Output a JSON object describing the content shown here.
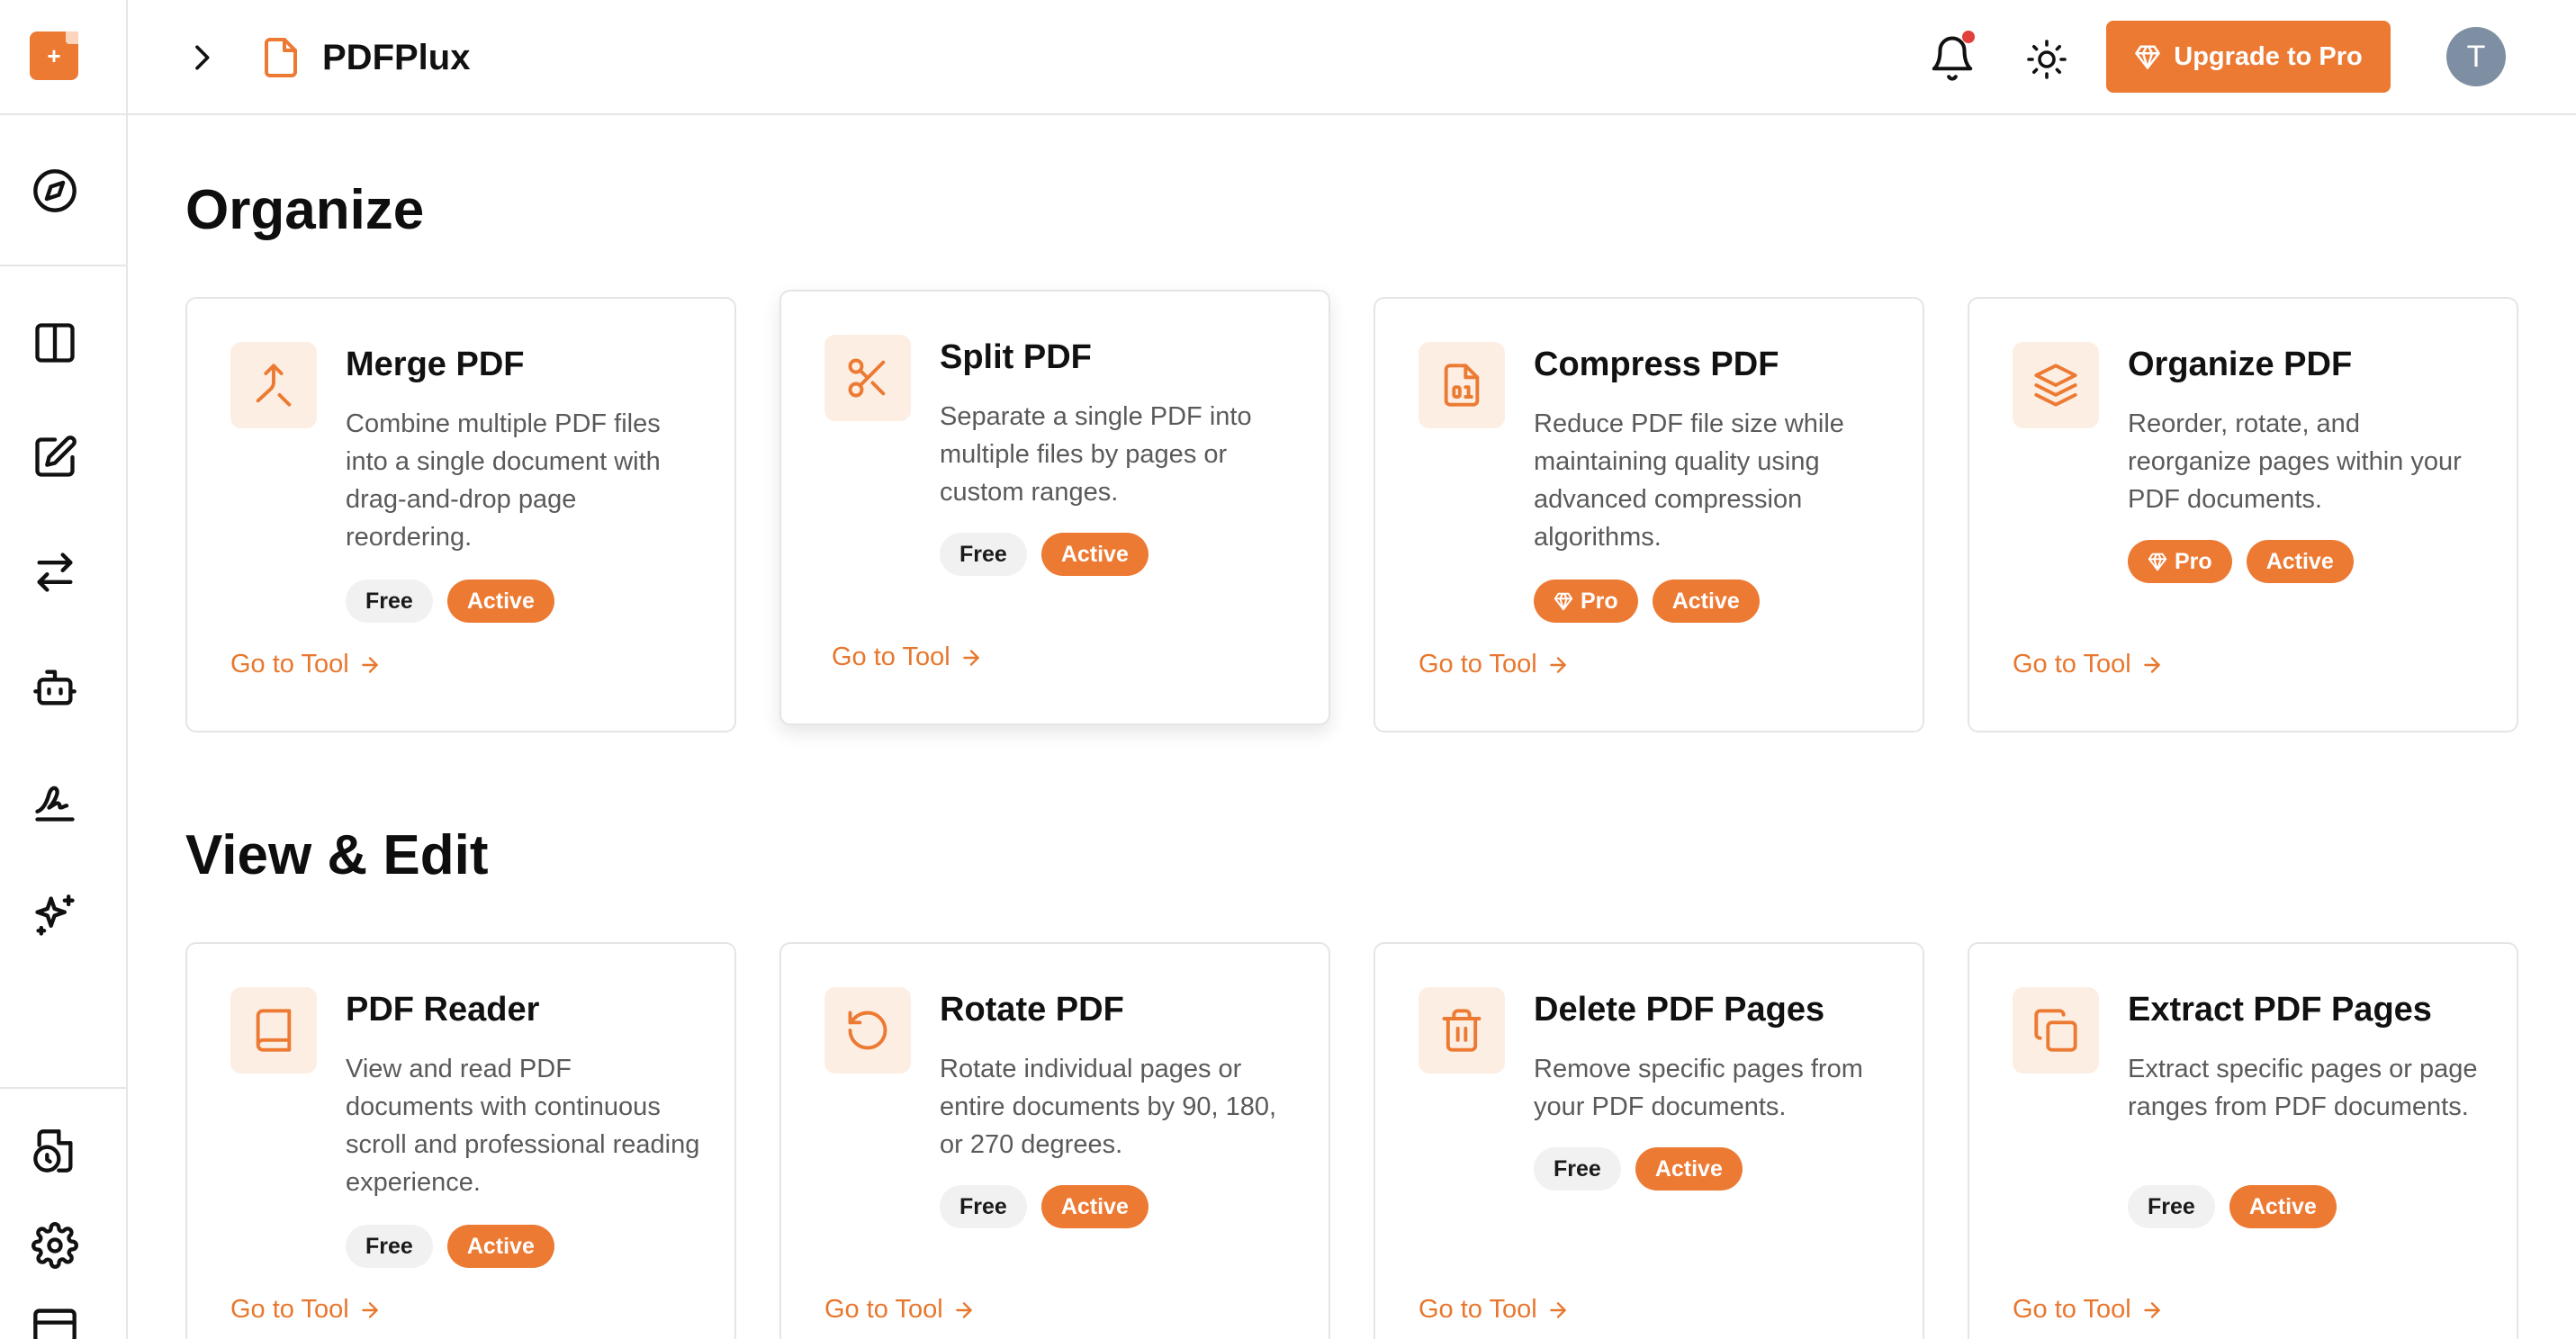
{
  "app": {
    "title": "PDFPlux",
    "logo_glyph": "+"
  },
  "header": {
    "upgrade_label": "Upgrade to Pro",
    "avatar_initial": "T",
    "notification_dot_color": "#e0413b"
  },
  "colors": {
    "accent": "#ec7a33",
    "accent_soft": "#fdeee3"
  },
  "sidebar": {
    "items": [
      {
        "icon": "compass-icon"
      },
      {
        "icon": "columns-icon"
      },
      {
        "icon": "edit-icon"
      },
      {
        "icon": "convert-arrows-icon"
      },
      {
        "icon": "bot-icon"
      },
      {
        "icon": "signature-icon"
      },
      {
        "icon": "sparkles-icon"
      },
      {
        "icon": "file-history-icon"
      },
      {
        "icon": "settings-icon"
      },
      {
        "icon": "credit-card-icon"
      }
    ]
  },
  "sections": [
    {
      "title": "Organize",
      "cards": [
        {
          "icon": "merge-icon",
          "title": "Merge PDF",
          "description": "Combine multiple PDF files into a single document with drag-and-drop page reordering.",
          "badges": [
            "Free",
            "Active"
          ],
          "link": "Go to Tool"
        },
        {
          "icon": "scissors-icon",
          "title": "Split PDF",
          "description": "Separate a single PDF into multiple files by pages or custom ranges.",
          "badges": [
            "Free",
            "Active"
          ],
          "link": "Go to Tool"
        },
        {
          "icon": "file-binary-icon",
          "title": "Compress PDF",
          "description": "Reduce PDF file size while maintaining quality using advanced compression algorithms.",
          "badges": [
            "Pro",
            "Active"
          ],
          "link": "Go to Tool"
        },
        {
          "icon": "layers-icon",
          "title": "Organize PDF",
          "description": "Reorder, rotate, and reorganize pages within your PDF documents.",
          "badges": [
            "Pro",
            "Active"
          ],
          "link": "Go to Tool"
        }
      ]
    },
    {
      "title": "View & Edit",
      "cards": [
        {
          "icon": "book-icon",
          "title": "PDF Reader",
          "description": "View and read PDF documents with continuous scroll and professional reading experience.",
          "badges": [
            "Free",
            "Active"
          ],
          "link": "Go to Tool"
        },
        {
          "icon": "rotate-ccw-icon",
          "title": "Rotate PDF",
          "description": "Rotate individual pages or entire documents by 90, 180, or 270 degrees.",
          "badges": [
            "Free",
            "Active"
          ],
          "link": "Go to Tool"
        },
        {
          "icon": "trash-icon",
          "title": "Delete PDF Pages",
          "description": "Remove specific pages from your PDF documents.",
          "badges": [
            "Free",
            "Active"
          ],
          "link": "Go to Tool"
        },
        {
          "icon": "copy-icon",
          "title": "Extract PDF Pages",
          "description": "Extract specific pages or page ranges from PDF documents.",
          "badges": [
            "Free",
            "Active"
          ],
          "link": "Go to Tool"
        }
      ]
    }
  ]
}
